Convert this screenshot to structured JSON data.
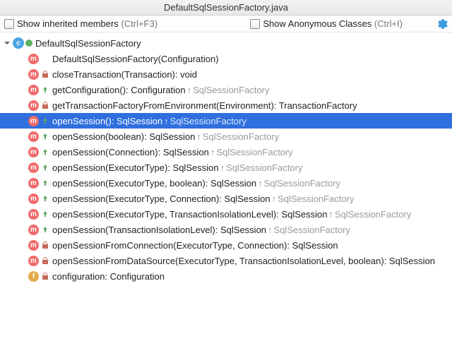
{
  "title": "DefaultSqlSessionFactory.java",
  "toolbar": {
    "show_inherited_label": "Show inherited members",
    "show_inherited_hint": "(Ctrl+F3)",
    "show_anon_label": "Show Anonymous Classes",
    "show_anon_hint": "(Ctrl+I)"
  },
  "class_name": "DefaultSqlSessionFactory",
  "members": [
    {
      "kind": "method",
      "visibility": "public",
      "override": false,
      "sig": "DefaultSqlSessionFactory(Configuration)",
      "super": ""
    },
    {
      "kind": "method",
      "visibility": "private",
      "override": false,
      "sig": "closeTransaction(Transaction): void",
      "super": ""
    },
    {
      "kind": "method",
      "visibility": "public",
      "override": true,
      "sig": "getConfiguration(): Configuration",
      "super": "SqlSessionFactory"
    },
    {
      "kind": "method",
      "visibility": "private",
      "override": false,
      "sig": "getTransactionFactoryFromEnvironment(Environment): TransactionFactory",
      "super": ""
    },
    {
      "kind": "method",
      "visibility": "public",
      "override": true,
      "sig": "openSession(): SqlSession",
      "super": "SqlSessionFactory",
      "selected": true
    },
    {
      "kind": "method",
      "visibility": "public",
      "override": true,
      "sig": "openSession(boolean): SqlSession",
      "super": "SqlSessionFactory"
    },
    {
      "kind": "method",
      "visibility": "public",
      "override": true,
      "sig": "openSession(Connection): SqlSession",
      "super": "SqlSessionFactory"
    },
    {
      "kind": "method",
      "visibility": "public",
      "override": true,
      "sig": "openSession(ExecutorType): SqlSession",
      "super": "SqlSessionFactory"
    },
    {
      "kind": "method",
      "visibility": "public",
      "override": true,
      "sig": "openSession(ExecutorType, boolean): SqlSession",
      "super": "SqlSessionFactory"
    },
    {
      "kind": "method",
      "visibility": "public",
      "override": true,
      "sig": "openSession(ExecutorType, Connection): SqlSession",
      "super": "SqlSessionFactory"
    },
    {
      "kind": "method",
      "visibility": "public",
      "override": true,
      "sig": "openSession(ExecutorType, TransactionIsolationLevel): SqlSession",
      "super": "SqlSessionFactory"
    },
    {
      "kind": "method",
      "visibility": "public",
      "override": true,
      "sig": "openSession(TransactionIsolationLevel): SqlSession",
      "super": "SqlSessionFactory"
    },
    {
      "kind": "method",
      "visibility": "private",
      "override": false,
      "sig": "openSessionFromConnection(ExecutorType, Connection): SqlSession",
      "super": ""
    },
    {
      "kind": "method",
      "visibility": "private",
      "override": false,
      "sig": "openSessionFromDataSource(ExecutorType, TransactionIsolationLevel, boolean): SqlSession",
      "super": ""
    },
    {
      "kind": "field",
      "visibility": "private",
      "override": false,
      "sig": "configuration: Configuration",
      "super": ""
    }
  ]
}
